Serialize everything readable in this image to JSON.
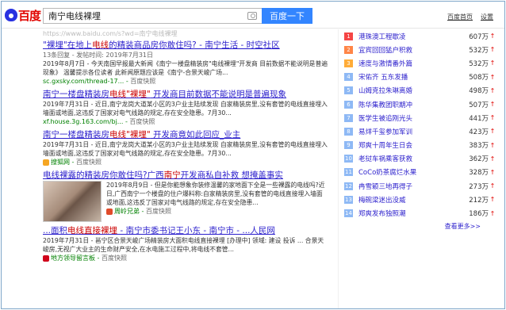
{
  "header": {
    "logo_text": "百度",
    "query": "南宁电线裸埋",
    "search_button": "百度一下",
    "links": [
      "百度首页",
      "设置"
    ]
  },
  "results_top_url": "https://www.baidu.com/s?wd=南宁电线裸埋",
  "results": [
    {
      "title_pre": "\"裸埋\"在地上",
      "title_hl": "电线",
      "title_post": "的精装商品房你敢住吗? - 南宁生活 - 时空社区",
      "meta": "13条回复 - 发帖时间: 2019年7月31日",
      "abs": "2019年8月7日 - 今天南国早报最大新闻《南宁一楼盘精装房\"电线裸埋\"开发商 目前数据不能说明是普遍现象》 温馨提示各位读者 此新闻原题应该是《南宁-合景天峻广场...",
      "url": "sc.gxsky.com/thread-17...",
      "snapshot": "百度快照"
    },
    {
      "title_pre": "南宁一楼盘精装房",
      "title_hl": "电线\"裸埋\"",
      "title_post": " 开发商目前数据不能说明是普遍现象",
      "meta": "",
      "abs": "2019年7月31日 - 近日,南宁龙岗大道某小区的3户业主陆续发现 自家精装房里,没有套管的电线直接埋入墙面或地面,这违反了国家对电气线路的规定,存在安全隐患。7月30...",
      "url": "xf.house.3g.163.com/bj...",
      "snapshot": "百度快照"
    },
    {
      "title_pre": "南宁一楼盘精装房",
      "title_hl": "电线\"裸埋\"",
      "title_post": " 开发商竟如此回应_业主",
      "meta": "",
      "abs": "2019年7月31日 - 近日,南宁龙岗大道某小区的3户业主陆续发现 自家精装房里,没有套管的电线直接埋入墙面或地面,这违反了国家对电气线路的规定,存在安全隐患。7月30...",
      "url": "搜狐网",
      "snapshot": "百度快照"
    },
    {
      "title_pre": "电线裸露的精装房你敢住吗?广西",
      "title_hl": "南宁",
      "title_post": "开发商私自补救 想掩盖事实",
      "meta": "",
      "abs": "2019年8月9日 - 但是你能想象你装修温馨的家地面下全是一些裸露的电线吗?近日,广西南宁一个楼盘的住户爆料称:自家精装房里,没有套管的电线直接埋入墙面或地面,这违反了国家对电气线路的规定,存在安全隐患...",
      "url": "周岭兄弟",
      "snapshot": "百度快照"
    },
    {
      "title_pre": "...面积",
      "title_hl": "电线直接裸埋",
      "title_post": " - 南宁市委书记王小东 - 南宁市 - ...人民网",
      "meta": "",
      "abs": "2019年7月31日 - 邕宁区合景天峻广场精装房大面积电线直接裸埋 [办理中] 领域: 建设 投诉 ... 合景天峻房,无视广大业主的生命财产安全,在水电施工过程中,将电线不套管...",
      "url": "地方领导留言板",
      "snapshot": "百度快照"
    }
  ],
  "ranking": [
    {
      "num": "1",
      "title": "港珠澳工程歇凌",
      "value": "607万",
      "color": "#f54545"
    },
    {
      "num": "2",
      "title": "宜宾回回猛户积救",
      "value": "532万",
      "color": "#ff8547"
    },
    {
      "num": "3",
      "title": "速度与激情番外篇",
      "value": "532万",
      "color": "#ffac38"
    },
    {
      "num": "4",
      "title": "宋佑齐 五东发播",
      "value": "508万",
      "color": "#8eb9f5"
    },
    {
      "num": "5",
      "title": "山姆克拉朱琳离婚",
      "value": "498万",
      "color": "#8eb9f5"
    },
    {
      "num": "6",
      "title": "陈华集教团职期冲",
      "value": "507万",
      "color": "#8eb9f5"
    },
    {
      "num": "7",
      "title": "医学生被追刚光头",
      "value": "441万",
      "color": "#8eb9f5"
    },
    {
      "num": "8",
      "title": "易烊千玺参加军训",
      "value": "423万",
      "color": "#8eb9f5"
    },
    {
      "num": "9",
      "title": "郑爽十周年生日会",
      "value": "383万",
      "color": "#8eb9f5"
    },
    {
      "num": "10",
      "title": "老挝车祸乘客获救",
      "value": "362万",
      "color": "#8eb9f5"
    },
    {
      "num": "11",
      "title": "CoCo奶茶腐烂水果",
      "value": "328万",
      "color": "#8eb9f5"
    },
    {
      "num": "12",
      "title": "冉雪颖三地再得子",
      "value": "273万",
      "color": "#8eb9f5"
    },
    {
      "num": "13",
      "title": "梅碗梁迷出没威",
      "value": "212万",
      "color": "#8eb9f5"
    },
    {
      "num": "14",
      "title": "郑爽发布独照潮",
      "value": "186万",
      "color": "#8eb9f5"
    }
  ],
  "ranking_more": "查看更多>>"
}
